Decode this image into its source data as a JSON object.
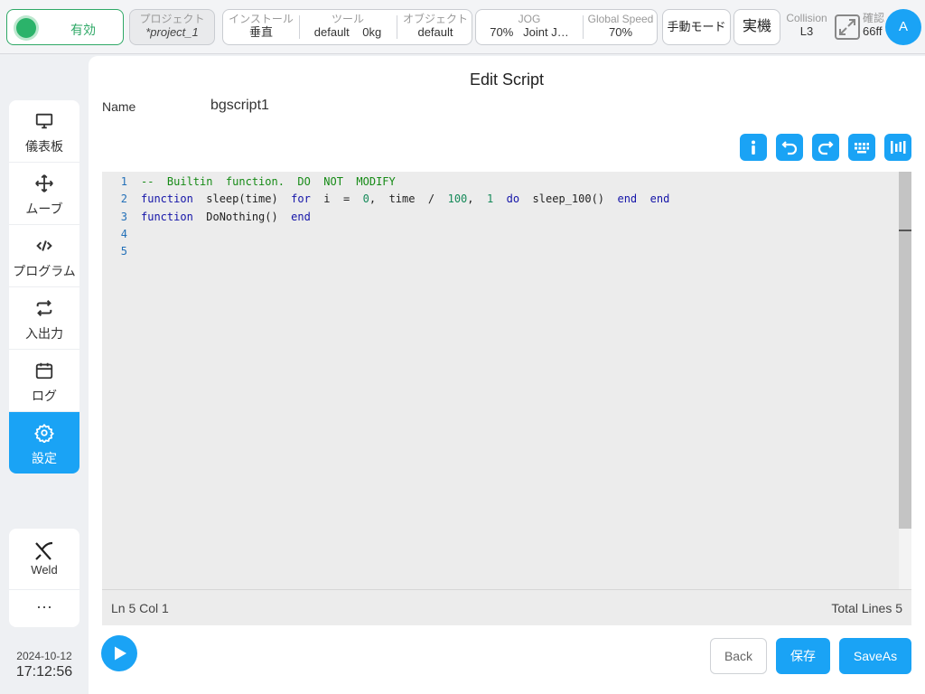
{
  "topbar": {
    "status": "有効",
    "project": {
      "label": "プロジェクト",
      "value": "*project_1"
    },
    "install": {
      "label": "インストール",
      "value": "垂直"
    },
    "tool": {
      "label": "ツール",
      "value": "default",
      "weight": "0kg"
    },
    "object": {
      "label": "オブジェクト",
      "value": "default"
    },
    "jog": {
      "label": "JOG",
      "value": "70%",
      "mode": "Joint J…"
    },
    "global_speed": {
      "label": "Global Speed",
      "value": "70%"
    },
    "manual_mode": "手動モード",
    "real_machine": "実機",
    "collision": {
      "label": "Collision",
      "value": "L3"
    },
    "confirm": {
      "label": "確認",
      "value": "66ff"
    },
    "avatar": "A"
  },
  "sidebar": {
    "items": [
      {
        "label": "儀表板",
        "icon": "monitor-icon"
      },
      {
        "label": "ムーブ",
        "icon": "move-icon"
      },
      {
        "label": "プログラム",
        "icon": "code-icon"
      },
      {
        "label": "入出力",
        "icon": "io-icon"
      },
      {
        "label": "ログ",
        "icon": "calendar-icon"
      },
      {
        "label": "設定",
        "icon": "gear-icon",
        "active": true
      }
    ],
    "weld": {
      "label": "Weld",
      "icon": "weld-icon"
    },
    "more": "···",
    "date": "2024-10-12",
    "time": "17:12:56"
  },
  "editor": {
    "title": "Edit Script",
    "name_label": "Name",
    "name_value": "bgscript1",
    "toolbar": [
      "info-icon",
      "undo-icon",
      "redo-icon",
      "keyboard-icon",
      "columns-icon"
    ],
    "code_lines": [
      {
        "num": "1",
        "tokens": [
          {
            "t": "--  Builtin  function.  DO  NOT  MODIFY",
            "c": "cm"
          }
        ]
      },
      {
        "num": "2",
        "tokens": [
          {
            "t": "function",
            "c": "kw"
          },
          {
            "t": "  sleep(time)  ",
            "c": "tx"
          },
          {
            "t": "for",
            "c": "kw"
          },
          {
            "t": "  i  =  ",
            "c": "tx"
          },
          {
            "t": "0",
            "c": "nm"
          },
          {
            "t": ",  time  /  ",
            "c": "tx"
          },
          {
            "t": "100",
            "c": "nm"
          },
          {
            "t": ",  ",
            "c": "tx"
          },
          {
            "t": "1",
            "c": "nm"
          },
          {
            "t": "  ",
            "c": "tx"
          },
          {
            "t": "do",
            "c": "kw"
          },
          {
            "t": "  sleep_100()  ",
            "c": "tx"
          },
          {
            "t": "end",
            "c": "kw"
          },
          {
            "t": "  ",
            "c": "tx"
          },
          {
            "t": "end",
            "c": "kw"
          }
        ]
      },
      {
        "num": "3",
        "tokens": [
          {
            "t": "function",
            "c": "kw"
          },
          {
            "t": "  DoNothing()  ",
            "c": "tx"
          },
          {
            "t": "end",
            "c": "kw"
          }
        ]
      },
      {
        "num": "4",
        "tokens": []
      },
      {
        "num": "5",
        "tokens": []
      }
    ],
    "cursor_position": "Ln 5 Col 1",
    "total_lines": "Total Lines 5"
  },
  "footer": {
    "back": "Back",
    "save": "保存",
    "save_as": "SaveAs"
  },
  "colors": {
    "accent": "#1aa3f5",
    "status_green": "#2bb36a"
  }
}
